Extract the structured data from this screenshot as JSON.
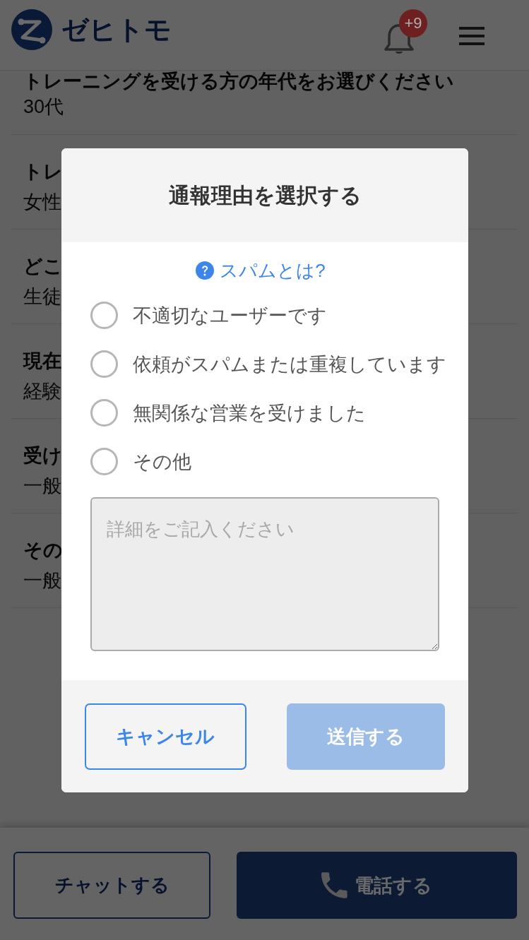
{
  "header": {
    "logo_text": "ゼヒトモ",
    "notification_badge": "+9"
  },
  "answers": [
    {
      "question": "トレーニングを受ける方の年代をお選びください",
      "answer": "30代"
    },
    {
      "question": "トレ",
      "answer": "女性"
    },
    {
      "question": "どこ",
      "answer": "生徒"
    },
    {
      "question": "現在",
      "answer": "経験"
    },
    {
      "question": "受け",
      "answer": "一般"
    },
    {
      "question": "その",
      "answer": "一般"
    }
  ],
  "dialog": {
    "title": "通報理由を選択する",
    "help_link": "スパムとは?",
    "reasons": [
      {
        "label": "不適切なユーザーです",
        "selected": false
      },
      {
        "label": "依頼がスパムまたは重複しています",
        "selected": false
      },
      {
        "label": "無関係な営業を受けました",
        "selected": false
      },
      {
        "label": "その他",
        "selected": false
      }
    ],
    "details": {
      "placeholder": "詳細をご記入ください"
    },
    "buttons": [
      {
        "kind": "secondary",
        "label": "キャンセル",
        "disabled": false
      },
      {
        "kind": "primary",
        "label": "送信する",
        "disabled": true
      }
    ]
  },
  "action_bar": {
    "buttons": [
      {
        "kind": "chat",
        "label": "チャットする"
      },
      {
        "kind": "call",
        "label": "電話する"
      }
    ]
  }
}
